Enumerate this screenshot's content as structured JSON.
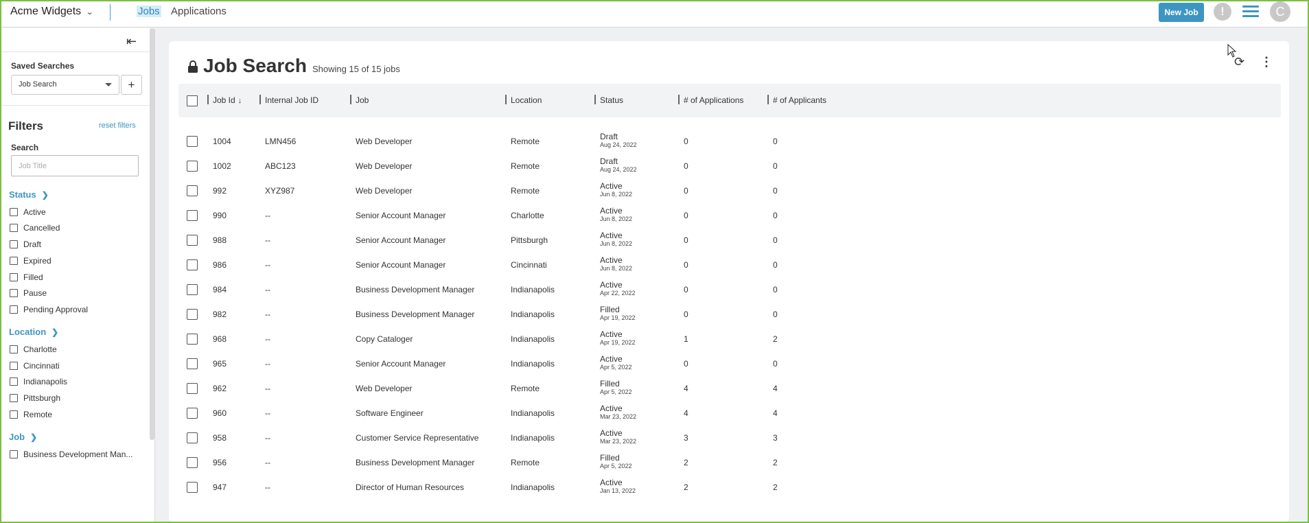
{
  "topbar": {
    "company": "Acme Widgets",
    "tabs": [
      {
        "label": "Jobs",
        "active": true
      },
      {
        "label": "Applications",
        "active": false
      }
    ],
    "new_job_label": "New Job",
    "avatar_initial": "C",
    "alert_glyph": "!"
  },
  "sidebar": {
    "saved_searches_label": "Saved Searches",
    "saved_search_selected": "Job Search",
    "add_glyph": "+",
    "filters_label": "Filters",
    "reset_label": "reset filters",
    "search_label": "Search",
    "search_placeholder": "Job Title",
    "status_label": "Status",
    "status_items": [
      "Active",
      "Cancelled",
      "Draft",
      "Expired",
      "Filled",
      "Pause",
      "Pending Approval"
    ],
    "location_label": "Location",
    "location_items": [
      "Charlotte",
      "Cincinnati",
      "Indianapolis",
      "Pittsburgh",
      "Remote"
    ],
    "job_label": "Job",
    "job_items": [
      "Business Development Man..."
    ]
  },
  "main": {
    "title": "Job Search",
    "showing": "Showing 15 of 15 jobs",
    "columns": {
      "job_id": "Job Id",
      "internal_id": "Internal Job ID",
      "job": "Job",
      "location": "Location",
      "status": "Status",
      "applications": "# of Applications",
      "applicants": "# of Applicants"
    },
    "rows": [
      {
        "id": "1004",
        "internal": "LMN456",
        "job": "Web Developer",
        "location": "Remote",
        "status": "Draft",
        "date": "Aug 24, 2022",
        "apps": "0",
        "applicants": "0"
      },
      {
        "id": "1002",
        "internal": "ABC123",
        "job": "Web Developer",
        "location": "Remote",
        "status": "Draft",
        "date": "Aug 24, 2022",
        "apps": "0",
        "applicants": "0"
      },
      {
        "id": "992",
        "internal": "XYZ987",
        "job": "Web Developer",
        "location": "Remote",
        "status": "Active",
        "date": "Jun 8, 2022",
        "apps": "0",
        "applicants": "0"
      },
      {
        "id": "990",
        "internal": "--",
        "job": "Senior Account Manager",
        "location": "Charlotte",
        "status": "Active",
        "date": "Jun 8, 2022",
        "apps": "0",
        "applicants": "0"
      },
      {
        "id": "988",
        "internal": "--",
        "job": "Senior Account Manager",
        "location": "Pittsburgh",
        "status": "Active",
        "date": "Jun 8, 2022",
        "apps": "0",
        "applicants": "0"
      },
      {
        "id": "986",
        "internal": "--",
        "job": "Senior Account Manager",
        "location": "Cincinnati",
        "status": "Active",
        "date": "Jun 8, 2022",
        "apps": "0",
        "applicants": "0"
      },
      {
        "id": "984",
        "internal": "--",
        "job": "Business Development Manager",
        "location": "Indianapolis",
        "status": "Active",
        "date": "Apr 22, 2022",
        "apps": "0",
        "applicants": "0"
      },
      {
        "id": "982",
        "internal": "--",
        "job": "Business Development Manager",
        "location": "Indianapolis",
        "status": "Filled",
        "date": "Apr 19, 2022",
        "apps": "0",
        "applicants": "0"
      },
      {
        "id": "968",
        "internal": "--",
        "job": "Copy Cataloger",
        "location": "Indianapolis",
        "status": "Active",
        "date": "Apr 19, 2022",
        "apps": "1",
        "applicants": "2"
      },
      {
        "id": "965",
        "internal": "--",
        "job": "Senior Account Manager",
        "location": "Indianapolis",
        "status": "Active",
        "date": "Apr 5, 2022",
        "apps": "0",
        "applicants": "0"
      },
      {
        "id": "962",
        "internal": "--",
        "job": "Web Developer",
        "location": "Remote",
        "status": "Filled",
        "date": "Apr 5, 2022",
        "apps": "4",
        "applicants": "4"
      },
      {
        "id": "960",
        "internal": "--",
        "job": "Software Engineer",
        "location": "Indianapolis",
        "status": "Active",
        "date": "Mar 23, 2022",
        "apps": "4",
        "applicants": "4"
      },
      {
        "id": "958",
        "internal": "--",
        "job": "Customer Service Representative",
        "location": "Indianapolis",
        "status": "Active",
        "date": "Mar 23, 2022",
        "apps": "3",
        "applicants": "3"
      },
      {
        "id": "956",
        "internal": "--",
        "job": "Business Development Manager",
        "location": "Remote",
        "status": "Filled",
        "date": "Apr 5, 2022",
        "apps": "2",
        "applicants": "2"
      },
      {
        "id": "947",
        "internal": "--",
        "job": "Director of Human Resources",
        "location": "Indianapolis",
        "status": "Active",
        "date": "Jan 13, 2022",
        "apps": "2",
        "applicants": "2"
      }
    ]
  },
  "icons": {
    "chevron_down": "chevron-down-icon",
    "collapse": "collapse-sidebar-icon",
    "lock": "lock-icon",
    "refresh": "refresh-icon",
    "more": "more-vertical-icon",
    "sort": "sort-descending-icon",
    "menu": "hamburger-menu-icon",
    "alert": "alert-icon"
  },
  "colors": {
    "accent": "#3d96c2",
    "window_border": "#7bc043",
    "background": "#eef0f2"
  }
}
